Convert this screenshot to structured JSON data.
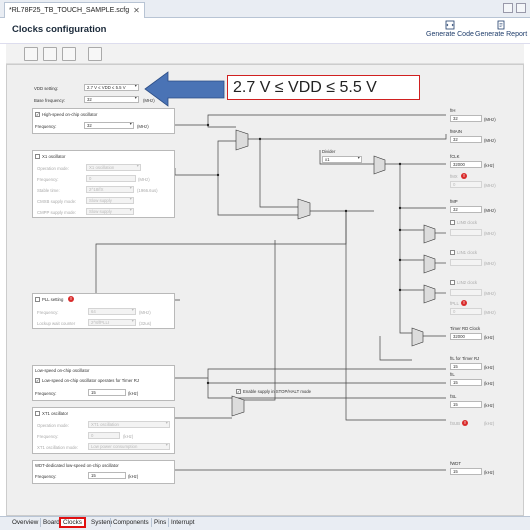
{
  "tab": {
    "label": "*RL78F25_TB_TOUCH_SAMPLE.scfg",
    "close": "✕"
  },
  "header": {
    "title": "Clocks configuration",
    "generate_code": "Generate Code",
    "generate_report": "Generate Report"
  },
  "callout": "2.7 V ≤ VDD ≤ 5.5 V",
  "vdd": {
    "label": "VDD setting:",
    "value": "2.7 V ≤ VDD ≤ 5.5 V"
  },
  "base": {
    "label": "Base frequency:",
    "value": "32",
    "unit": "(MHz)"
  },
  "hoco": {
    "label": "High-speed on-chip oscillator",
    "freq_label": "Frequency:",
    "freq": "32",
    "unit": "(MHz)",
    "checked": "✓"
  },
  "x1": {
    "label": "X1 oscillator",
    "mode_label": "Operation mode:",
    "mode": "X1 oscillation",
    "freq_label": "Frequency:",
    "freq": "0",
    "unit": "(MHz)",
    "stable_label": "Stable time:",
    "stable": "2^18/fX",
    "stable_unit": "(1966.6us)",
    "cmxb_label": "CMXB supply mode:",
    "cmxb": "Slow supply",
    "cmp_label": "CMPP supply mode:",
    "cmp": "Slow supply"
  },
  "pll": {
    "label": "PLL setting",
    "freq_label": "Frequency:",
    "freq": "64",
    "unit": "(MHz)",
    "lockup_label": "Lockup wait counter",
    "lockup": "2^8/fPLLI",
    "lockup_unit": "(32us)"
  },
  "loco": {
    "label": "Low-speed on-chip oscillator",
    "timer_label": "Low-speed on-chip oscillator operates for Timer RJ",
    "freq_label": "Frequency:",
    "freq": "15",
    "unit": "(kHz)",
    "checked": "✓"
  },
  "xt1": {
    "label": "XT1 oscillator",
    "mode_label": "Operation mode:",
    "mode": "XT1 oscillation",
    "freq_label": "Frequency:",
    "freq": "0",
    "unit": "(kHz)",
    "osc_label": "XT1 oscillation mode:",
    "osc": "Low power consumption"
  },
  "wdt": {
    "label": "WDT-dedicated low-speed on-chip oscillator",
    "freq_label": "Frequency:",
    "freq": "15",
    "unit": "(kHz)"
  },
  "enable_stop": {
    "label": "Enable supply in STOP/HALT mode",
    "checked": "✓"
  },
  "divider": {
    "label": "Divider",
    "value": "x1"
  },
  "outputs": {
    "fih": {
      "label": "fIH",
      "value": "32",
      "unit": "(MHz)"
    },
    "fmain": {
      "label": "fMAIN",
      "value": "32",
      "unit": "(MHz)"
    },
    "fclk": {
      "label": "fCLK",
      "value": "32000",
      "unit": "(kHz)"
    },
    "fmx": {
      "label": "fMX",
      "value": "0",
      "unit": "(MHz)"
    },
    "fmp": {
      "label": "fMP",
      "value": "32",
      "unit": "(MHz)"
    },
    "lin0": {
      "label": "LIN0 clock",
      "value": "",
      "unit": "(MHz)"
    },
    "lin1": {
      "label": "LIN1 clock",
      "value": "",
      "unit": "(MHz)"
    },
    "lin2": {
      "label": "LIN2 clock",
      "value": "",
      "unit": "(MHz)"
    },
    "fpll": {
      "label": "fPLL",
      "value": "0",
      "unit": "(MHz)"
    },
    "timerrd": {
      "label": "Timer RD Clock",
      "value": "32000",
      "unit": "(kHz)"
    },
    "filrj": {
      "label": "fIL for Timer RJ",
      "value": "15",
      "unit": "(kHz)"
    },
    "fil": {
      "label": "fIL",
      "value": "15",
      "unit": "(kHz)"
    },
    "fsl": {
      "label": "fSL",
      "value": "15",
      "unit": "(kHz)"
    },
    "fsub": {
      "label": "fSUB",
      "value": "0",
      "unit": "(kHz)"
    },
    "fwdt": {
      "label": "fWDT",
      "value": "15",
      "unit": "(kHz)"
    }
  },
  "bottom_tabs": [
    "Overview",
    "Board",
    "Clocks",
    "System",
    "Components",
    "Pins",
    "Interrupt"
  ],
  "icons": {
    "error": "!",
    "arrow": "left-arrow-callout"
  },
  "colors": {
    "accent_red": "#d02020",
    "arrow_blue": "#4a73b5"
  }
}
